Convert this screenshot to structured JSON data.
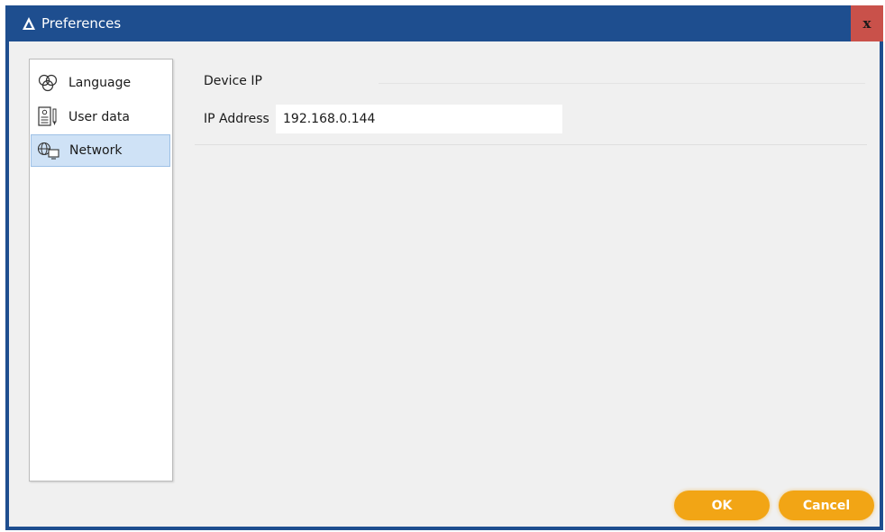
{
  "window": {
    "title": "Preferences",
    "close_glyph": "x",
    "app_icon": "app-logo-icon"
  },
  "sidebar": {
    "items": [
      {
        "label": "Language",
        "icon": "language-icon",
        "selected": false
      },
      {
        "label": "User data",
        "icon": "user-data-icon",
        "selected": false
      },
      {
        "label": "Network",
        "icon": "network-icon",
        "selected": true
      }
    ]
  },
  "network": {
    "section_title": "Device IP",
    "ip_label": "IP Address",
    "ip_value": "192.168.0.144"
  },
  "buttons": {
    "ok_label": "OK",
    "cancel_label": "Cancel"
  },
  "colors": {
    "titlebar": "#1e4e8f",
    "close_button": "#c9514a",
    "accent_button": "#f2a515",
    "selected_item": "#cfe2f6"
  }
}
